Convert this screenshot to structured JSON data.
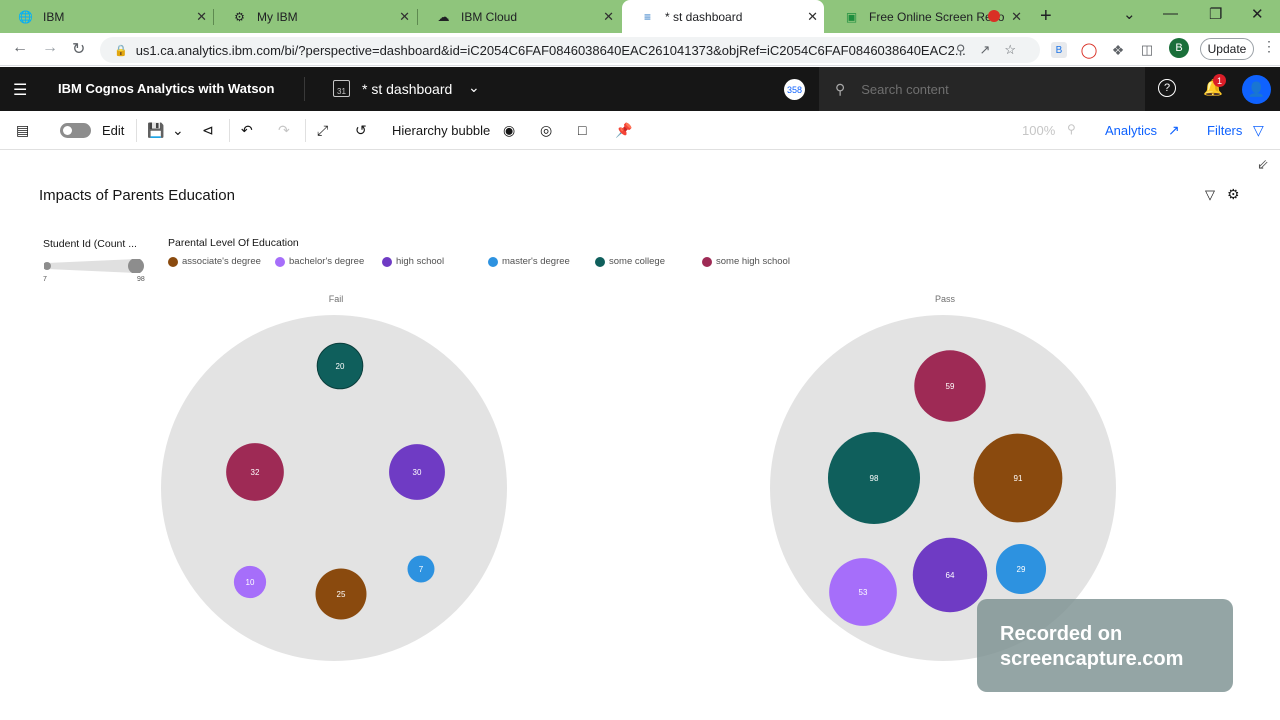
{
  "browser": {
    "tabs": [
      {
        "title": "IBM",
        "icon": "globe-icon",
        "active": false
      },
      {
        "title": "My IBM",
        "icon": "ibm-icon",
        "active": false
      },
      {
        "title": "IBM Cloud",
        "icon": "cloud-icon",
        "active": false
      },
      {
        "title": "* st dashboard",
        "icon": "cognos-icon",
        "active": true
      },
      {
        "title": "Free Online Screen Reco",
        "icon": "screen-recorder-icon",
        "active": false
      }
    ],
    "url": "us1.ca.analytics.ibm.com/bi/?perspective=dashboard&id=iC2054C6FAF0846038640EAC261041373&objRef=iC2054C6FAF0846038640EAC2...",
    "profile_initial": "B",
    "update_label": "Update"
  },
  "app": {
    "brand": "IBM Cognos Analytics with Watson",
    "dashboard_name": "* st dashboard",
    "badge_count": "358",
    "search_placeholder": "Search content",
    "notification_count": "1"
  },
  "toolbar": {
    "edit_label": "Edit",
    "widget_label": "Hierarchy bubble",
    "zoom_label": "100%",
    "analytics_label": "Analytics",
    "filters_label": "Filters"
  },
  "watermark": {
    "line1": "Recorded on",
    "line2": "screencapture.com"
  },
  "chart_data": {
    "type": "hierarchy bubble",
    "title": "Impacts of Parents Education",
    "size_legend": {
      "title": "Student Id (Count ...",
      "min": "7",
      "max": "98"
    },
    "color_legend": {
      "title": "Parental Level Of Education",
      "items": [
        {
          "name": "associate's degree",
          "color": "#8a4a0e"
        },
        {
          "name": "bachelor's degree",
          "color": "#a66efa"
        },
        {
          "name": "high school",
          "color": "#6f3bc4"
        },
        {
          "name": "master's degree",
          "color": "#2d92e0"
        },
        {
          "name": "some college",
          "color": "#0f5f5c"
        },
        {
          "name": "some high school",
          "color": "#9e2a55"
        }
      ]
    },
    "groups": [
      {
        "name": "Fail",
        "values": [
          {
            "category": "some college",
            "value": 20
          },
          {
            "category": "some high school",
            "value": 32
          },
          {
            "category": "high school",
            "value": 30
          },
          {
            "category": "bachelor's degree",
            "value": 10
          },
          {
            "category": "associate's degree",
            "value": 25
          },
          {
            "category": "master's degree",
            "value": 7
          }
        ]
      },
      {
        "name": "Pass",
        "values": [
          {
            "category": "some high school",
            "value": 59
          },
          {
            "category": "some college",
            "value": 98
          },
          {
            "category": "associate's degree",
            "value": 91
          },
          {
            "category": "bachelor's degree",
            "value": 53
          },
          {
            "category": "high school",
            "value": 64
          },
          {
            "category": "master's degree",
            "value": 29
          }
        ]
      }
    ]
  }
}
